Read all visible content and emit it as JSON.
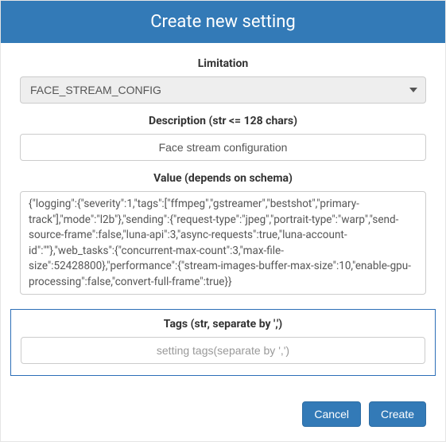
{
  "modal": {
    "title": "Create new setting",
    "fields": {
      "limitation": {
        "label": "Limitation",
        "value": "FACE_STREAM_CONFIG"
      },
      "description": {
        "label": "Description (str <= 128 chars)",
        "value": "Face stream configuration"
      },
      "value": {
        "label": "Value (depends on schema)",
        "value": "{\"logging\":{\"severity\":1,\"tags\":[\"ffmpeg\",\"gstreamer\",\"bestshot\",\"primary-track\"],\"mode\":\"l2b\"},\"sending\":{\"request-type\":\"jpeg\",\"portrait-type\":\"warp\",\"send-source-frame\":false,\"luna-api\":3,\"async-requests\":true,\"luna-account-id\":\"\"},\"web_tasks\":{\"concurrent-max-count\":3,\"max-file-size\":52428800},\"performance\":{\"stream-images-buffer-max-size\":10,\"enable-gpu-processing\":false,\"convert-full-frame\":true}}"
      },
      "tags": {
        "label": "Tags (str, separate by ',')",
        "placeholder": "setting tags(separate by ',')"
      }
    },
    "buttons": {
      "cancel": "Cancel",
      "create": "Create"
    }
  }
}
